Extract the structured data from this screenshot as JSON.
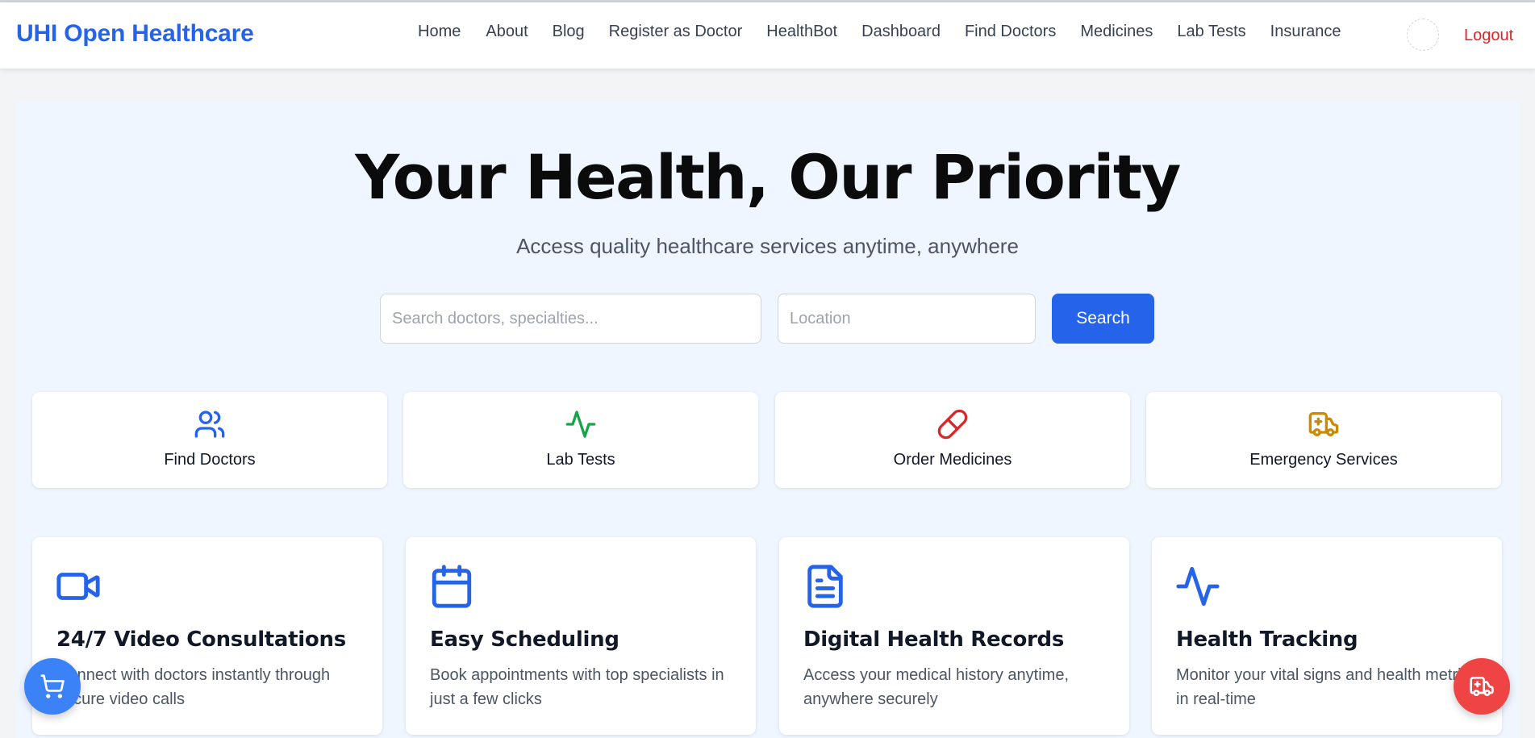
{
  "brand": "UHI Open Healthcare",
  "nav": {
    "links": [
      "Home",
      "About",
      "Blog",
      "Register as Doctor",
      "HealthBot",
      "Dashboard",
      "Find Doctors",
      "Medicines",
      "Lab Tests",
      "Insurance"
    ],
    "logout": "Logout"
  },
  "hero": {
    "title": "Your Health, Our Priority",
    "subtitle": "Access quality healthcare services anytime, anywhere",
    "search_placeholder": "Search doctors, specialties...",
    "location_placeholder": "Location",
    "search_button": "Search"
  },
  "quick_actions": [
    {
      "label": "Find Doctors",
      "icon": "users-icon",
      "color": "#2563eb"
    },
    {
      "label": "Lab Tests",
      "icon": "activity-icon",
      "color": "#16a34a"
    },
    {
      "label": "Order Medicines",
      "icon": "pill-icon",
      "color": "#dc2626"
    },
    {
      "label": "Emergency Services",
      "icon": "ambulance-icon",
      "color": "#ca8a04"
    }
  ],
  "features": [
    {
      "title": "24/7 Video Consultations",
      "desc": "Connect with doctors instantly through secure video calls",
      "icon": "video-icon"
    },
    {
      "title": "Easy Scheduling",
      "desc": "Book appointments with top specialists in just a few clicks",
      "icon": "calendar-icon"
    },
    {
      "title": "Digital Health Records",
      "desc": "Access your medical history anytime, anywhere securely",
      "icon": "file-text-icon"
    },
    {
      "title": "Health Tracking",
      "desc": "Monitor your vital signs and health metrics in real-time",
      "icon": "activity-icon"
    }
  ],
  "colors": {
    "primary": "#2563eb",
    "danger": "#dc2626",
    "hero_bg": "#eff6ff"
  },
  "floating": {
    "cart_icon": "shopping-cart-icon",
    "emergency_icon": "ambulance-icon"
  }
}
